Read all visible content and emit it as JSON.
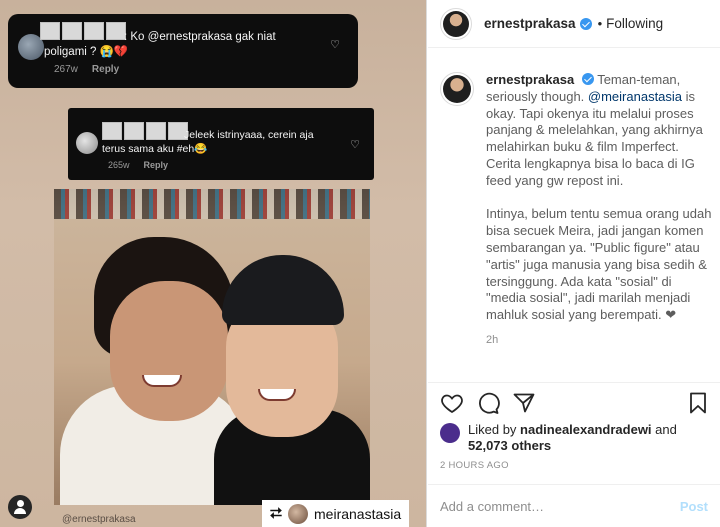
{
  "media": {
    "comments": [
      {
        "text": ": Ko @ernestprakasa gak niat poligami ? 😭💔",
        "age": "267w",
        "reply_label": "Reply"
      },
      {
        "text": "Jeleek istrinyaaa, cerein aja terus sama aku #eh😂",
        "age": "265w",
        "reply_label": "Reply"
      }
    ],
    "credit": "@ernestprakasa",
    "repost_user": "meiranastasia"
  },
  "post": {
    "username": "ernestprakasa",
    "follow_status": "Following",
    "caption_user": "ernestprakasa",
    "caption_before_mention": "Teman-teman, seriously though. ",
    "caption_mention": "@meiranastasia",
    "caption_after_mention": " is okay. Tapi okenya itu melalui proses panjang & melelahkan, yang akhirnya melahirkan buku & film Imperfect. Cerita lengkapnya bisa lo baca di IG feed yang gw repost ini.\n\nIntinya, belum tentu semua orang udah bisa secuek Meira, jadi jangan komen sembarangan ya. \"Public figure\" atau \"artis\" juga manusia yang bisa sedih & tersinggung. Ada kata \"sosial\" di \"media sosial\", jadi marilah menjadi mahluk sosial yang berempati. ❤",
    "caption_time": "2h",
    "liked_by_prefix": "Liked by ",
    "liked_by_user": "nadinealexandradewi",
    "liked_by_and": " and ",
    "likes_count": "52,073 others",
    "posted_ago": "2 HOURS AGO",
    "comment_placeholder": "Add a comment…",
    "post_label": "Post"
  },
  "colors": {
    "accent": "#3897f0",
    "mention": "#00376b",
    "post_disabled": "#b2dffc"
  }
}
